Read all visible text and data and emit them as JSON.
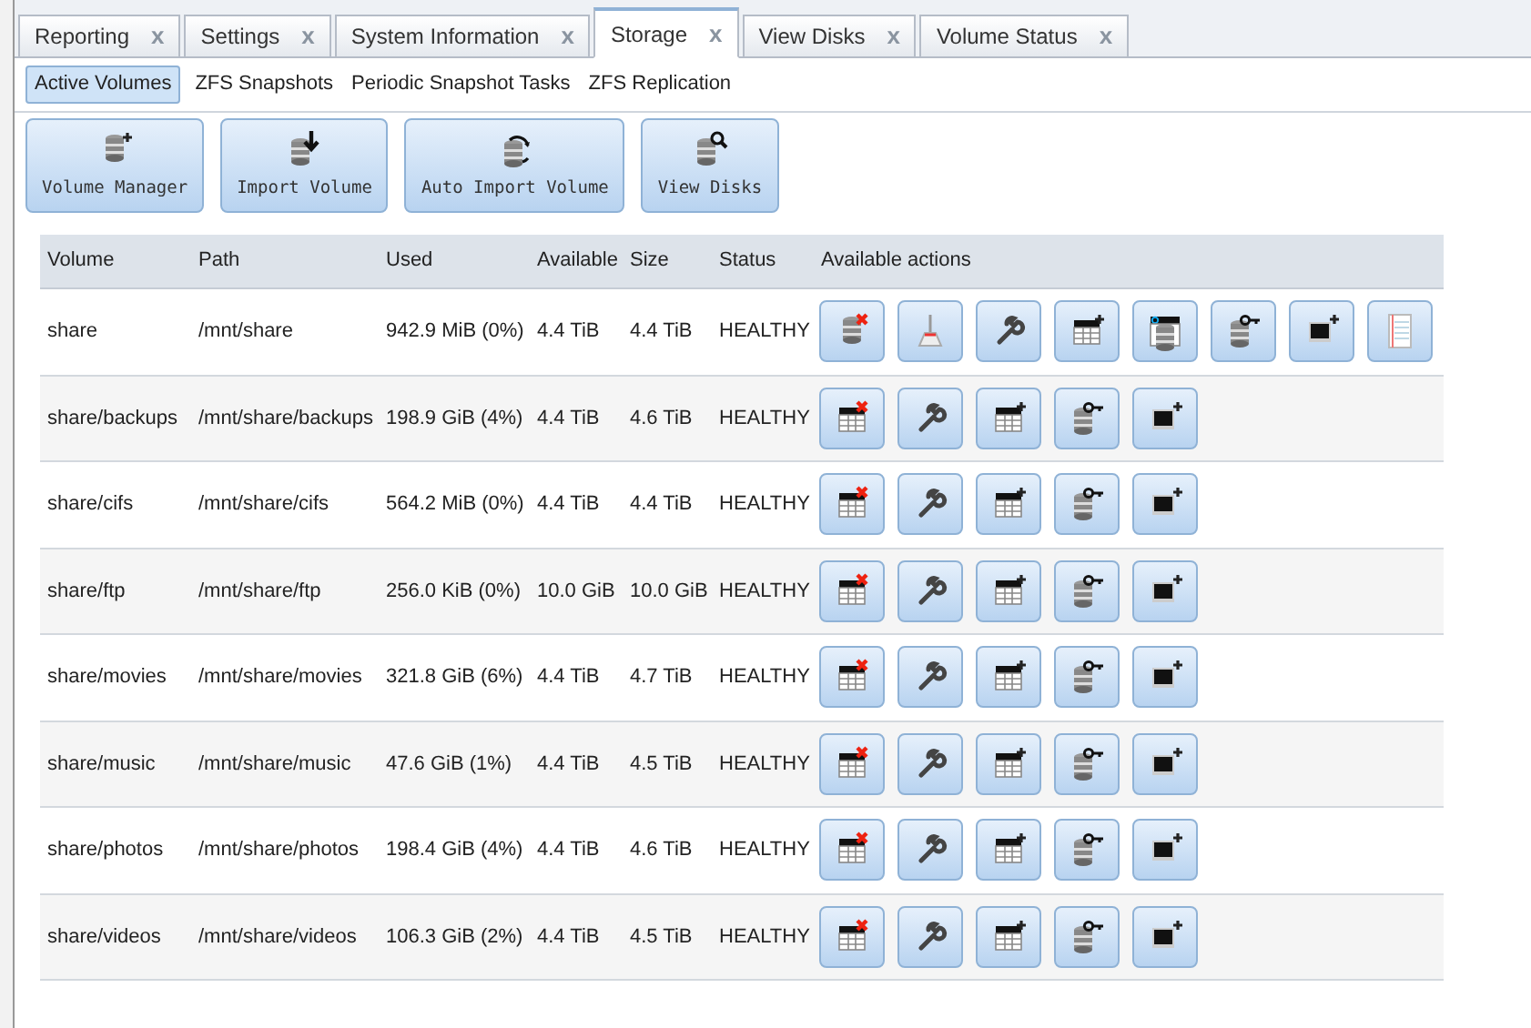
{
  "tabs": [
    {
      "label": "Reporting",
      "close": "x",
      "selected": false
    },
    {
      "label": "Settings",
      "close": "x",
      "selected": false
    },
    {
      "label": "System Information",
      "close": "x",
      "selected": false
    },
    {
      "label": "Storage",
      "close": "x",
      "selected": true
    },
    {
      "label": "View Disks",
      "close": "x",
      "selected": false
    },
    {
      "label": "Volume Status",
      "close": "x",
      "selected": false
    }
  ],
  "subtabs": [
    {
      "label": "Active Volumes",
      "selected": true
    },
    {
      "label": "ZFS Snapshots",
      "selected": false
    },
    {
      "label": "Periodic Snapshot Tasks",
      "selected": false
    },
    {
      "label": "ZFS Replication",
      "selected": false
    }
  ],
  "toolbar": [
    {
      "label": "Volume Manager",
      "kind": "add"
    },
    {
      "label": "Import Volume",
      "kind": "import"
    },
    {
      "label": "Auto Import Volume",
      "kind": "auto"
    },
    {
      "label": "View Disks",
      "kind": "view"
    }
  ],
  "table": {
    "columns": [
      "Volume",
      "Path",
      "Used",
      "Available",
      "Size",
      "Status",
      "Available actions"
    ],
    "rows": [
      {
        "cells": [
          "share",
          "/mnt/share",
          "942.9 MiB (0%)",
          "4.4 TiB",
          "4.4 TiB",
          "HEALTHY"
        ],
        "actions": [
          {
            "kind": "destroyvolume"
          },
          {
            "kind": "scrub"
          },
          {
            "kind": "edit"
          },
          {
            "kind": "adddataset"
          },
          {
            "kind": "permissions"
          },
          {
            "kind": "key"
          },
          {
            "kind": "addzvol"
          },
          {
            "kind": "notes"
          }
        ]
      },
      {
        "cells": [
          "share/backups",
          "/mnt/share/backups",
          "198.9 GiB (4%)",
          "4.4 TiB",
          "4.6 TiB",
          "HEALTHY"
        ],
        "actions": [
          {
            "kind": "destroydataset"
          },
          {
            "kind": "edit"
          },
          {
            "kind": "adddataset"
          },
          {
            "kind": "key"
          },
          {
            "kind": "addzvol"
          }
        ]
      },
      {
        "cells": [
          "share/cifs",
          "/mnt/share/cifs",
          "564.2 MiB (0%)",
          "4.4 TiB",
          "4.4 TiB",
          "HEALTHY"
        ],
        "actions": [
          {
            "kind": "destroydataset"
          },
          {
            "kind": "edit"
          },
          {
            "kind": "adddataset"
          },
          {
            "kind": "key"
          },
          {
            "kind": "addzvol"
          }
        ]
      },
      {
        "cells": [
          "share/ftp",
          "/mnt/share/ftp",
          "256.0 KiB (0%)",
          "10.0 GiB",
          "10.0 GiB",
          "HEALTHY"
        ],
        "actions": [
          {
            "kind": "destroydataset"
          },
          {
            "kind": "edit"
          },
          {
            "kind": "adddataset"
          },
          {
            "kind": "key"
          },
          {
            "kind": "addzvol"
          }
        ]
      },
      {
        "cells": [
          "share/movies",
          "/mnt/share/movies",
          "321.8 GiB (6%)",
          "4.4 TiB",
          "4.7 TiB",
          "HEALTHY"
        ],
        "actions": [
          {
            "kind": "destroydataset"
          },
          {
            "kind": "edit"
          },
          {
            "kind": "adddataset"
          },
          {
            "kind": "key"
          },
          {
            "kind": "addzvol"
          }
        ]
      },
      {
        "cells": [
          "share/music",
          "/mnt/share/music",
          "47.6 GiB (1%)",
          "4.4 TiB",
          "4.5 TiB",
          "HEALTHY"
        ],
        "actions": [
          {
            "kind": "destroydataset"
          },
          {
            "kind": "edit"
          },
          {
            "kind": "adddataset"
          },
          {
            "kind": "key"
          },
          {
            "kind": "addzvol"
          }
        ]
      },
      {
        "cells": [
          "share/photos",
          "/mnt/share/photos",
          "198.4 GiB (4%)",
          "4.4 TiB",
          "4.6 TiB",
          "HEALTHY"
        ],
        "actions": [
          {
            "kind": "destroydataset"
          },
          {
            "kind": "edit"
          },
          {
            "kind": "adddataset"
          },
          {
            "kind": "key"
          },
          {
            "kind": "addzvol"
          }
        ]
      },
      {
        "cells": [
          "share/videos",
          "/mnt/share/videos",
          "106.3 GiB (2%)",
          "4.4 TiB",
          "4.5 TiB",
          "HEALTHY"
        ],
        "actions": [
          {
            "kind": "destroydataset"
          },
          {
            "kind": "edit"
          },
          {
            "kind": "adddataset"
          },
          {
            "kind": "key"
          },
          {
            "kind": "addzvol"
          }
        ]
      }
    ]
  }
}
